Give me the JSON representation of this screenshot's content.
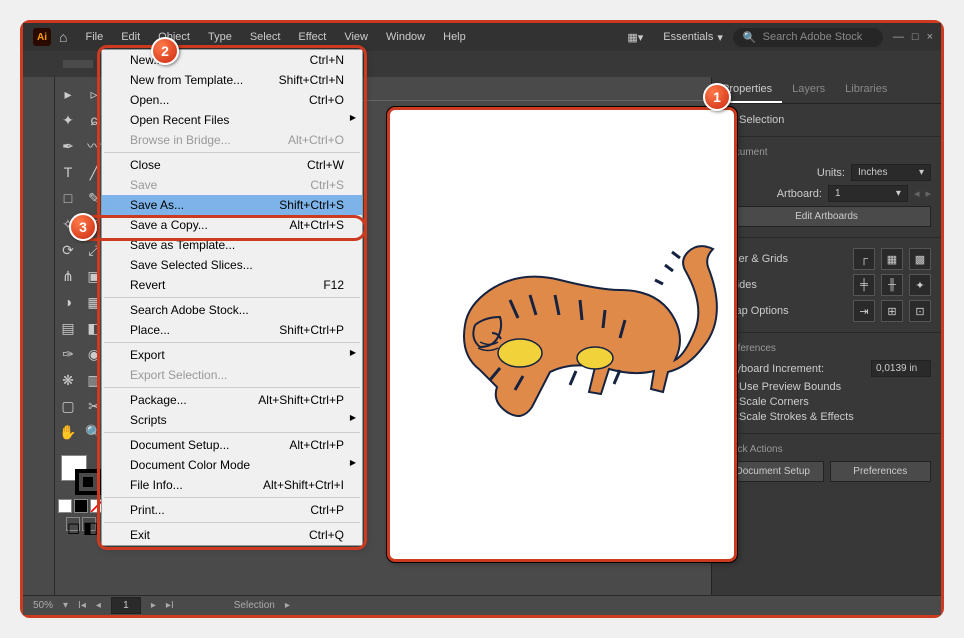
{
  "app": {
    "logo": "Ai"
  },
  "menubar": [
    "File",
    "Edit",
    "Object",
    "Type",
    "Select",
    "Effect",
    "View",
    "Window",
    "Help"
  ],
  "workspace": {
    "label": "Essentials",
    "search_placeholder": "Search Adobe Stock"
  },
  "winbtns": [
    "—",
    "□",
    "×"
  ],
  "tab": {
    "label": ""
  },
  "filemenu": [
    {
      "label": "New...",
      "short": "Ctrl+N"
    },
    {
      "label": "New from Template...",
      "short": "Shift+Ctrl+N"
    },
    {
      "label": "Open...",
      "short": "Ctrl+O"
    },
    {
      "label": "Open Recent Files",
      "sub": true
    },
    {
      "label": "Browse in Bridge...",
      "short": "Alt+Ctrl+O",
      "disabled": true
    },
    {
      "sep": true
    },
    {
      "label": "Close",
      "short": "Ctrl+W"
    },
    {
      "label": "Save",
      "short": "Ctrl+S",
      "disabled": true
    },
    {
      "label": "Save As...",
      "short": "Shift+Ctrl+S",
      "hl": true
    },
    {
      "label": "Save a Copy...",
      "short": "Alt+Ctrl+S"
    },
    {
      "label": "Save as Template..."
    },
    {
      "label": "Save Selected Slices..."
    },
    {
      "label": "Revert",
      "short": "F12"
    },
    {
      "sep": true
    },
    {
      "label": "Search Adobe Stock..."
    },
    {
      "label": "Place...",
      "short": "Shift+Ctrl+P"
    },
    {
      "sep": true
    },
    {
      "label": "Export",
      "sub": true
    },
    {
      "label": "Export Selection...",
      "disabled": true
    },
    {
      "sep": true
    },
    {
      "label": "Package...",
      "short": "Alt+Shift+Ctrl+P"
    },
    {
      "label": "Scripts",
      "sub": true
    },
    {
      "sep": true
    },
    {
      "label": "Document Setup...",
      "short": "Alt+Ctrl+P"
    },
    {
      "label": "Document Color Mode",
      "sub": true
    },
    {
      "label": "File Info...",
      "short": "Alt+Shift+Ctrl+I"
    },
    {
      "sep": true
    },
    {
      "label": "Print...",
      "short": "Ctrl+P"
    },
    {
      "sep": true
    },
    {
      "label": "Exit",
      "short": "Ctrl+Q"
    }
  ],
  "status": {
    "zoom": "50%",
    "page": "1",
    "mode": "Selection"
  },
  "rpanel": {
    "tabs": [
      "Properties",
      "Layers",
      "Libraries"
    ],
    "nosel": "No Selection",
    "doc": "Document",
    "units_lbl": "Units:",
    "units_val": "Inches",
    "artboard_lbl": "Artboard:",
    "artboard_val": "1",
    "edit_artboards": "Edit Artboards",
    "ruler": "Ruler & Grids",
    "guides": "Guides",
    "snap": "Snap Options",
    "prefs_sec": "Preferences",
    "kb_inc_lbl": "Keyboard Increment:",
    "kb_inc_val": "0,0139 in",
    "chk1": "Use Preview Bounds",
    "chk2": "Scale Corners",
    "chk3": "Scale Strokes & Effects",
    "qa": "Quick Actions",
    "qa1": "Document Setup",
    "qa2": "Preferences"
  },
  "badges": {
    "n1": "1",
    "n2": "2",
    "n3": "3"
  }
}
